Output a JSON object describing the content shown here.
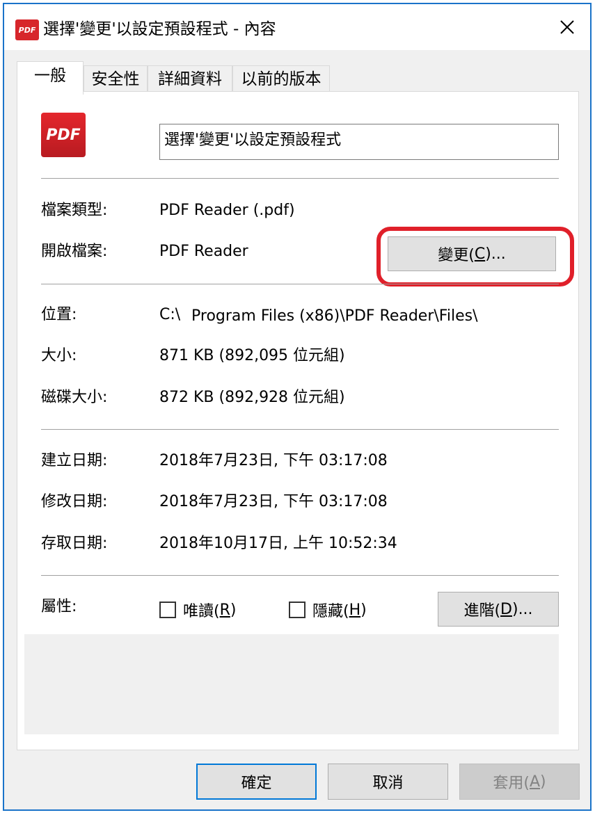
{
  "window": {
    "title": "選擇'變更'以設定預設程式 - 內容",
    "title_icon_text": "PDF"
  },
  "tabs": [
    {
      "label": "一般",
      "active": true
    },
    {
      "label": "安全性",
      "active": false
    },
    {
      "label": "詳細資料",
      "active": false
    },
    {
      "label": "以前的版本",
      "active": false
    }
  ],
  "general": {
    "logo_text": "PDF",
    "file_name": "選擇'變更'以設定預設程式",
    "file_type_label": "檔案類型:",
    "file_type_value": "PDF Reader (.pdf)",
    "opens_with_label": "開啟檔案:",
    "opens_with_value": "PDF Reader",
    "change_button": {
      "text": "變更(",
      "mnemonic": "C",
      "suffix": ")..."
    },
    "location_label": "位置:",
    "location_prefix": "C:\\",
    "location_value": "Program Files (x86)\\PDF Reader\\Files\\",
    "size_label": "大小:",
    "size_value": "871 KB (892,095 位元組)",
    "size_on_disk_label": "磁碟大小:",
    "size_on_disk_value": "872 KB (892,928 位元組)",
    "created_label": "建立日期:",
    "created_value": "2018年7月23日, 下午 03:17:08",
    "modified_label": "修改日期:",
    "modified_value": "2018年7月23日, 下午 03:17:08",
    "accessed_label": "存取日期:",
    "accessed_value": "2018年10月17日, 上午 10:52:34",
    "attributes_label": "屬性:",
    "readonly": {
      "text": "唯讀(",
      "mnemonic": "R",
      "suffix": ")",
      "checked": false
    },
    "hidden": {
      "text": "隱藏(",
      "mnemonic": "H",
      "suffix": ")",
      "checked": false
    },
    "advanced_button": {
      "text": "進階(",
      "mnemonic": "D",
      "suffix": ")..."
    }
  },
  "footer": {
    "ok_label": "確定",
    "cancel_label": "取消",
    "apply": {
      "text": "套用(",
      "mnemonic": "A",
      "suffix": ")"
    }
  },
  "colors": {
    "window_border": "#1a73c9",
    "highlight_ring": "#e0202a",
    "pdf_red": "#d7262b"
  }
}
